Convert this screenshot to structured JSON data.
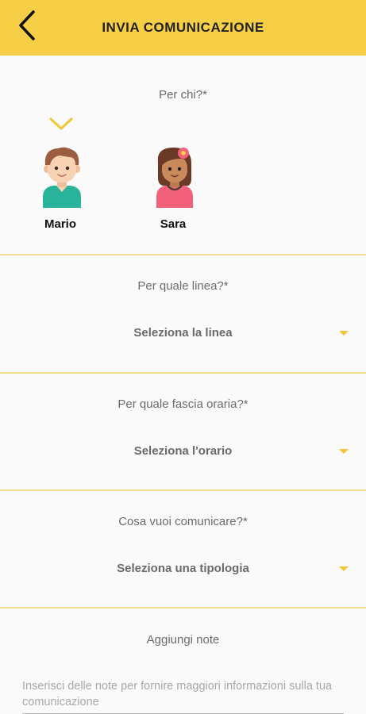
{
  "header": {
    "title": "INVIA COMUNICAZIONE",
    "background": "#f7cf46"
  },
  "recipients": {
    "label": "Per chi?*",
    "selected_index": 0,
    "items": [
      {
        "name": "Mario"
      },
      {
        "name": "Sara"
      }
    ]
  },
  "line": {
    "label": "Per quale linea?*",
    "value": "Seleziona la linea"
  },
  "time": {
    "label": "Per quale fascia oraria?*",
    "value": "Seleziona l'orario"
  },
  "type": {
    "label": "Cosa vuoi comunicare?*",
    "value": "Seleziona una tipologia"
  },
  "notes": {
    "label": "Aggiungi note",
    "placeholder": "Inserisci delle note per fornire maggiori informazioni sulla tua comunicazione"
  }
}
